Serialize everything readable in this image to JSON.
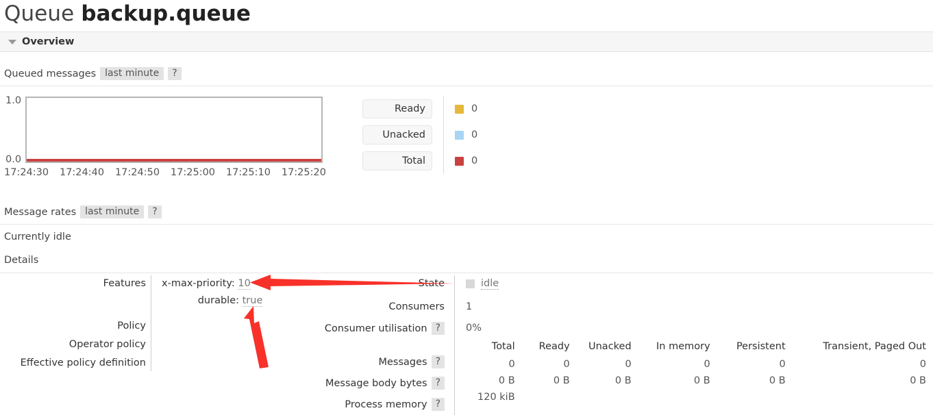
{
  "header": {
    "entity_label": "Queue",
    "queue_name": "backup.queue"
  },
  "section": {
    "toggle_icon": "triangle-down-icon",
    "title": "Overview"
  },
  "queued_messages": {
    "label": "Queued messages",
    "period_chip": "last minute",
    "help_chip": "?"
  },
  "message_rates": {
    "label": "Message rates",
    "period_chip": "last minute",
    "help_chip": "?",
    "status": "Currently idle"
  },
  "details_heading": "Details",
  "chart_data": {
    "type": "line",
    "title": "Queued messages",
    "xlabel": "",
    "ylabel": "",
    "ylim": [
      0.0,
      1.0
    ],
    "ytick_labels": [
      "1.0",
      "0.0"
    ],
    "x": [
      "17:24:30",
      "17:24:40",
      "17:24:50",
      "17:25:00",
      "17:25:10",
      "17:25:20"
    ],
    "grid": false,
    "legend_position": "right",
    "series": [
      {
        "name": "Ready",
        "color": "#e5b83c",
        "current": "0",
        "values": [
          0,
          0,
          0,
          0,
          0,
          0
        ]
      },
      {
        "name": "Unacked",
        "color": "#a7d5f2",
        "current": "0",
        "values": [
          0,
          0,
          0,
          0,
          0,
          0
        ]
      },
      {
        "name": "Total",
        "color": "#c9423f",
        "current": "0",
        "values": [
          0,
          0,
          0,
          0,
          0,
          0
        ]
      }
    ]
  },
  "details_left": {
    "rows": [
      {
        "label": "Features"
      },
      {
        "label": "Policy",
        "value": ""
      },
      {
        "label": "Operator policy",
        "value": ""
      },
      {
        "label": "Effective policy definition",
        "value": ""
      }
    ],
    "features": [
      {
        "key": "x-max-priority:",
        "value": "10"
      },
      {
        "key": "durable:",
        "value": "true"
      }
    ]
  },
  "details_right": {
    "state": {
      "label": "State",
      "value": "idle",
      "indicator": "grey-square"
    },
    "consumers": {
      "label": "Consumers",
      "value": "1"
    },
    "consumer_utilisation": {
      "label": "Consumer utilisation",
      "help_chip": "?",
      "value": "0%"
    }
  },
  "stats_table": {
    "columns": [
      "",
      "Total",
      "Ready",
      "Unacked",
      "In memory",
      "Persistent",
      "Transient, Paged Out"
    ],
    "rows": [
      {
        "label": "Messages",
        "help_chip": "?",
        "cells": [
          "0",
          "0",
          "0",
          "0",
          "0",
          "0"
        ]
      },
      {
        "label": "Message body bytes",
        "help_chip": "?",
        "cells": [
          "0 B",
          "0 B",
          "0 B",
          "0 B",
          "0 B",
          "0 B"
        ]
      },
      {
        "label": "Process memory",
        "help_chip": "?",
        "cells": [
          "120 kiB",
          "",
          "",
          "",
          "",
          ""
        ]
      }
    ]
  },
  "annotations": {
    "color": "#f8312a",
    "arrow_1_target": "x-max-priority value",
    "arrow_2_target": "durable value"
  }
}
